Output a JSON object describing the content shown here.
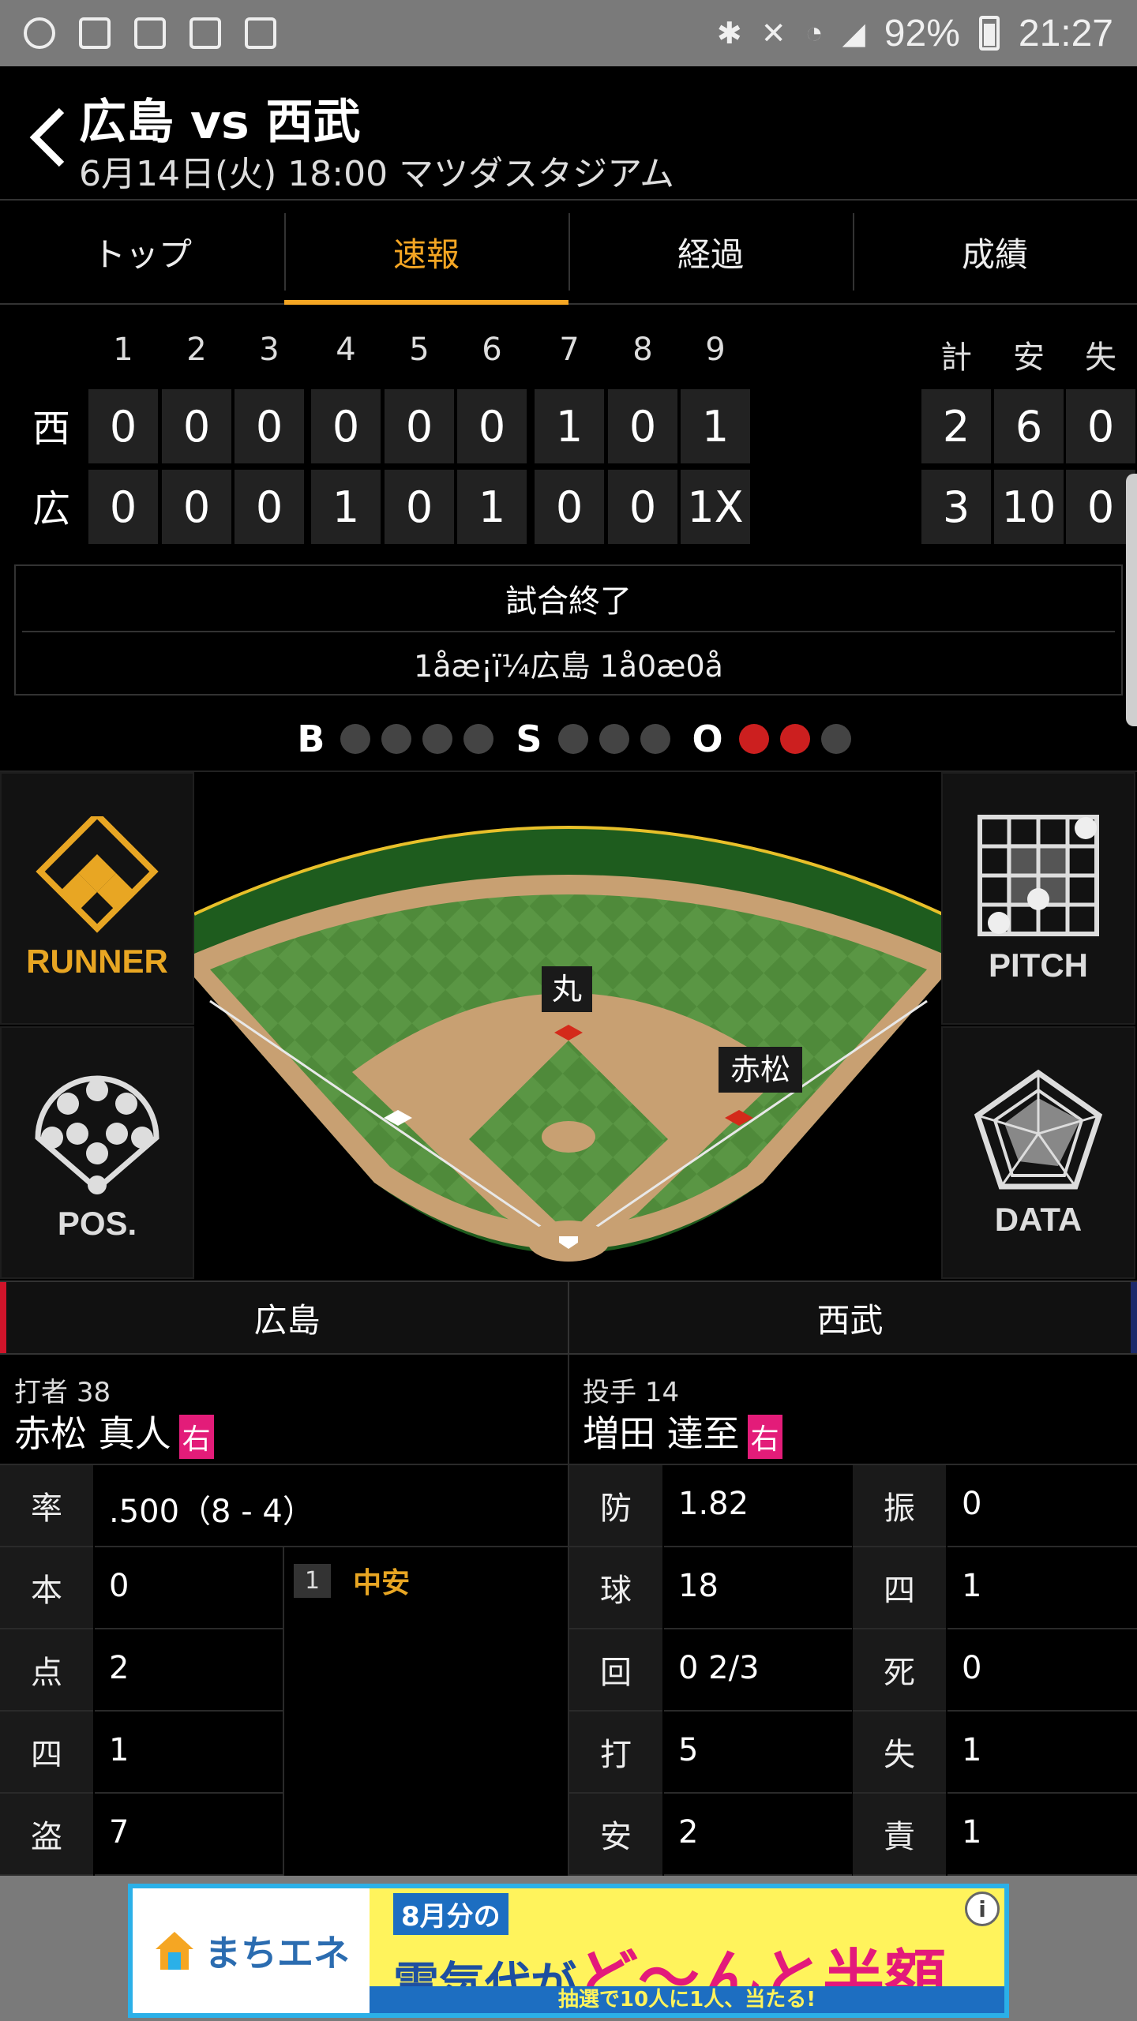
{
  "status_bar": {
    "battery": "92%",
    "time": "21:27"
  },
  "header": {
    "back_icon": "chevron-left",
    "title": "広島 vs 西武",
    "subtitle": "6月14日(火) 18:00 マツダスタジアム"
  },
  "tabs": [
    {
      "label": "トップ",
      "active": false
    },
    {
      "label": "速報",
      "active": true
    },
    {
      "label": "経過",
      "active": false
    },
    {
      "label": "成績",
      "active": false
    }
  ],
  "scoreboard": {
    "innings": [
      "1",
      "2",
      "3",
      "4",
      "5",
      "6",
      "7",
      "8",
      "9"
    ],
    "totals_headers": [
      "計",
      "安",
      "失"
    ],
    "teams": [
      {
        "abbr": "西",
        "innings": [
          "0",
          "0",
          "0",
          "0",
          "0",
          "0",
          "1",
          "0",
          "1"
        ],
        "totals": [
          "2",
          "6",
          "0"
        ]
      },
      {
        "abbr": "広",
        "innings": [
          "0",
          "0",
          "0",
          "1",
          "0",
          "1",
          "0",
          "0",
          "1X"
        ],
        "totals": [
          "3",
          "10",
          "0"
        ]
      }
    ]
  },
  "game_status": {
    "state": "試合終了",
    "play_text": "1åæ¡ï¼広島 1å0æ0å"
  },
  "count": {
    "balls_label": "B",
    "balls": 0,
    "balls_max": 4,
    "strikes_label": "S",
    "strikes": 0,
    "strikes_max": 3,
    "outs_label": "O",
    "outs": 2,
    "outs_max": 3
  },
  "side_buttons": {
    "runner": "RUNNER",
    "pitch": "PITCH",
    "pos": "POS.",
    "data": "DATA"
  },
  "field": {
    "second_base_player": "丸",
    "first_base_player": "赤松",
    "runners_on": [
      "first",
      "second"
    ]
  },
  "teams_bar": {
    "home": "広島",
    "away": "西武"
  },
  "batter": {
    "role_label": "打者",
    "number": "38",
    "name": "赤松 真人",
    "hand": "右",
    "stats": [
      {
        "key": "率",
        "value": ".500（8 - 4）"
      },
      {
        "key": "本",
        "value": "0"
      },
      {
        "key": "点",
        "value": "2"
      },
      {
        "key": "四",
        "value": "1"
      },
      {
        "key": "盗",
        "value": "7"
      }
    ],
    "at_bats": [
      {
        "number": "1",
        "result": "中安"
      }
    ]
  },
  "pitcher": {
    "role_label": "投手",
    "number": "14",
    "name": "増田 達至",
    "hand": "右",
    "stats_left": [
      {
        "key": "防",
        "value": "1.82"
      },
      {
        "key": "球",
        "value": "18"
      },
      {
        "key": "回",
        "value": "0 2/3"
      },
      {
        "key": "打",
        "value": "5"
      },
      {
        "key": "安",
        "value": "2"
      }
    ],
    "stats_right": [
      {
        "key": "振",
        "value": "0"
      },
      {
        "key": "四",
        "value": "1"
      },
      {
        "key": "死",
        "value": "0"
      },
      {
        "key": "失",
        "value": "1"
      },
      {
        "key": "責",
        "value": "1"
      }
    ]
  },
  "ad": {
    "brand": "まちエネ",
    "line1": "8月分の",
    "line2a": "電気代が",
    "line2b": "ど〜んと",
    "line2c": "半額",
    "line3": "抽選で10人に1人、当たる!"
  },
  "colors": {
    "accent": "#f5a623",
    "home_team": "#d0142a",
    "away_team": "#1b2a6b",
    "out_on": "#cc1f1f",
    "hand_badge": "#e31c79"
  }
}
